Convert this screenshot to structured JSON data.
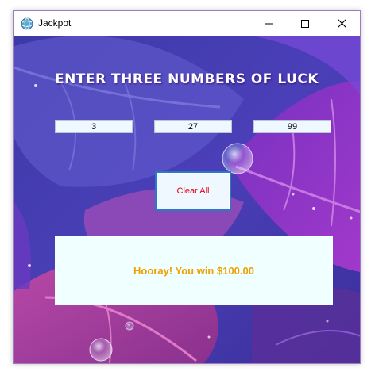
{
  "window": {
    "title": "Jackpot",
    "icon": "globe-icon",
    "controls": {
      "minimize": "minimize-icon",
      "maximize": "maximize-icon",
      "close": "close-icon"
    }
  },
  "main": {
    "heading": "ENTER THREE NUMBERS OF LUCK",
    "inputs": [
      {
        "value": "3"
      },
      {
        "value": "27"
      },
      {
        "value": "99"
      }
    ],
    "clear_button_label": "Clear All",
    "result_message": "Hooray! You win $100.00"
  },
  "colors": {
    "background": "#4a3aa8",
    "input_background": "#f0f8ff",
    "button_text": "#e0001a",
    "button_border": "#2a78c8",
    "result_background": "#f0ffff",
    "result_text": "#f0a000"
  }
}
